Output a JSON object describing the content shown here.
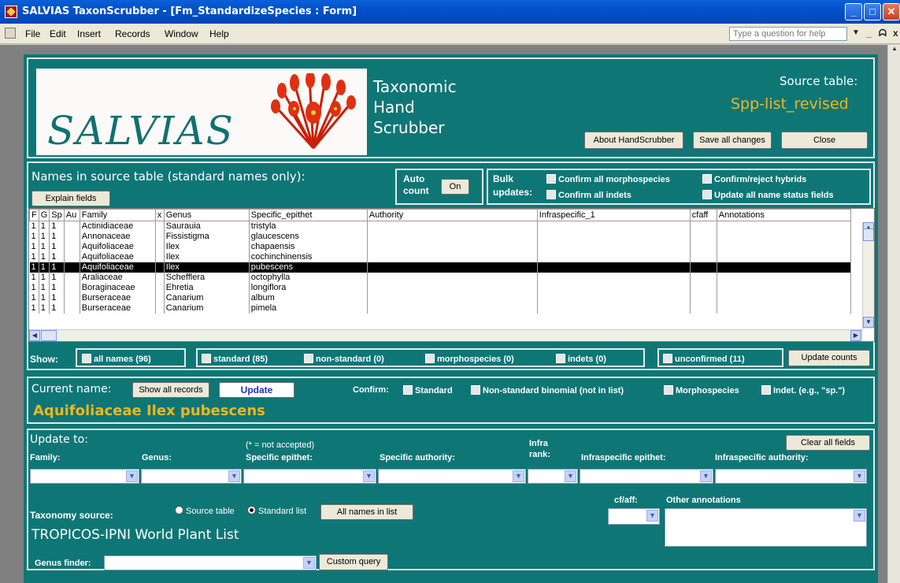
{
  "window": {
    "title": "SALVIAS TaxonScrubber - [Fm_StandardizeSpecies : Form]"
  },
  "menu": {
    "items": [
      "File",
      "Edit",
      "Insert",
      "Records",
      "Window",
      "Help"
    ],
    "help_placeholder": "Type a question for help"
  },
  "header": {
    "logo_text": "SALVIAS",
    "app_title_line1": "Taxonomic",
    "app_title_line2": "Hand",
    "app_title_line3": "Scrubber",
    "source_table_label": "Source table:",
    "source_table_value": "Spp-list_revised",
    "about_button": "About HandScrubber",
    "save_button": "Save all changes",
    "close_button": "Close"
  },
  "names_panel": {
    "heading": "Names in  source table (standard names only):",
    "explain_button": "Explain fields",
    "auto_count_line1": "Auto",
    "auto_count_line2": "count",
    "auto_count_toggle": "On",
    "bulk_line1": "Bulk",
    "bulk_line2": "updates:",
    "bulk_options": [
      "Confirm all morphospecies",
      "Confirm/reject hybrids",
      "Confirm all indets",
      "Update all name status fields"
    ]
  },
  "grid": {
    "columns": [
      "F",
      "G",
      "Sp",
      "Au",
      "Family",
      "x",
      "Genus",
      "Specific_epithet",
      "Authority",
      "Infraspecific_1",
      "cfaff",
      "Annotations"
    ],
    "rows": [
      {
        "f": "1",
        "g": "1",
        "sp": "1",
        "family": "Actinidiaceae",
        "genus": "Saurauia",
        "epithet": "tristyla"
      },
      {
        "f": "1",
        "g": "1",
        "sp": "1",
        "family": "Annonaceae",
        "genus": "Fissistigma",
        "epithet": "glaucescens"
      },
      {
        "f": "1",
        "g": "1",
        "sp": "1",
        "family": "Aquifoliaceae",
        "genus": "Ilex",
        "epithet": "chapaensis"
      },
      {
        "f": "1",
        "g": "1",
        "sp": "1",
        "family": "Aquifoliaceae",
        "genus": "Ilex",
        "epithet": "cochinchinensis"
      },
      {
        "f": "1",
        "g": "1",
        "sp": "1",
        "family": "Aquifoliaceae",
        "genus": "Ilex",
        "epithet": "pubescens",
        "selected": true
      },
      {
        "f": "1",
        "g": "1",
        "sp": "1",
        "family": "Araliaceae",
        "genus": "Schefflera",
        "epithet": "octophylla"
      },
      {
        "f": "1",
        "g": "1",
        "sp": "1",
        "family": "Boraginaceae",
        "genus": "Ehretia",
        "epithet": "longiflora"
      },
      {
        "f": "1",
        "g": "1",
        "sp": "1",
        "family": "Burseraceae",
        "genus": "Canarium",
        "epithet": "album"
      },
      {
        "f": "1",
        "g": "1",
        "sp": "1",
        "family": "Burseraceae",
        "genus": "Canarium",
        "epithet": "pimela"
      }
    ]
  },
  "show_filters": {
    "label": "Show:",
    "all_names": "all names  (96)",
    "standard": "standard  (85)",
    "non_standard": "non-standard  (0)",
    "morphospecies": "morphospecies  (0)",
    "indets": "indets  (0)",
    "unconfirmed": "unconfirmed  (11)",
    "update_counts_button": "Update counts"
  },
  "current": {
    "label": "Current name:",
    "show_all_button": "Show all records",
    "update_button": "Update",
    "name": "Aquifoliaceae Ilex pubescens",
    "confirm_label": "Confirm:",
    "confirm_options": [
      "Standard",
      "Non-standard binomial (not in list)",
      "Morphospecies",
      "Indet. (e.g., \"sp.\")"
    ]
  },
  "update_to": {
    "heading": "Update to:",
    "not_accepted_note": "(* = not accepted)",
    "clear_button": "Clear all fields",
    "labels": {
      "family": "Family:",
      "genus": "Genus:",
      "specific_epithet": "Specific epithet:",
      "specific_authority": "Specific authority:",
      "infra_rank_1": "Infra",
      "infra_rank_2": "rank:",
      "infraspecific_epithet": "Infraspecific epithet:",
      "infraspecific_authority": "Infraspecific authority:"
    },
    "taxonomy_source_label": "Taxonomy source:",
    "radio_source_table": "Source table",
    "radio_standard_list": "Standard list",
    "all_names_button": "All names in list",
    "taxonomy_name": "TROPICOS-IPNI World Plant List",
    "cfaff_label": "cf/aff:",
    "other_annotations_label": "Other annotations",
    "genus_finder_label": "Genus finder:",
    "custom_query_button": "Custom query"
  },
  "colors": {
    "form_bg": "#0f7676",
    "accent_yellow": "#f2b51a",
    "update_button_blue": "#1f2fb8",
    "titlebar_blue": "#0451c8"
  },
  "icons": [
    "app-icon",
    "minimize-icon",
    "maximize-icon",
    "close-icon",
    "checkbox-icon",
    "dropdown-arrow-icon",
    "scroll-arrow-icon"
  ]
}
